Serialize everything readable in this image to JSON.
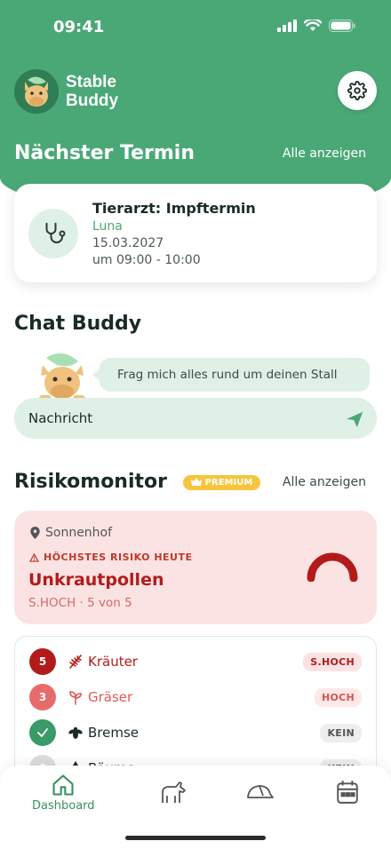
{
  "status_bar": {
    "time": "09:41"
  },
  "app": {
    "name_line1": "Stable",
    "name_line2": "Buddy"
  },
  "next_appointment": {
    "section_title": "Nächster Termin",
    "show_all": "Alle anzeigen",
    "title": "Tierarzt: Impftermin",
    "horse": "Luna",
    "date": "15.03.2027",
    "time": "um 09:00 - 10:00"
  },
  "chat": {
    "section_title": "Chat Buddy",
    "bubble": "Frag mich alles rund um deinen Stall",
    "input_placeholder": "Nachricht"
  },
  "risk": {
    "section_title": "Risikomonitor",
    "premium_label": "PREMIUM",
    "show_all": "Alle anzeigen",
    "location": "Sonnenhof",
    "highest_label": "HÖCHSTES RISIKO HEUTE",
    "highest_name": "Unkrautpollen",
    "highest_detail": "S.HOCH · 5 von 5",
    "highest_level": 5,
    "highest_max": 5,
    "items": [
      {
        "level": "5",
        "name": "Kräuter",
        "badge": "S.HOCH",
        "icon": "herb-icon",
        "color": "#b31b1b",
        "name_color": "#b31b1b",
        "badge_bg": "#fbe3e3",
        "badge_fg": "#b31b1b"
      },
      {
        "level": "3",
        "name": "Gräser",
        "badge": "HOCH",
        "icon": "sprout-icon",
        "color": "#e86b6b",
        "name_color": "#e05a5a",
        "badge_bg": "#fde7e7",
        "badge_fg": "#d9534f"
      },
      {
        "level": "",
        "name": "Bremse",
        "badge": "KEIN",
        "icon": "fly-icon",
        "color": "#3a9a68",
        "name_color": "#1a2b22",
        "badge_bg": "#eeeeee",
        "badge_fg": "#555555"
      },
      {
        "level": "0",
        "name": "Bäume",
        "badge": "KEIN",
        "icon": "tree-icon",
        "color": "#dddddd",
        "name_color": "#1a2b22",
        "badge_bg": "#eeeeee",
        "badge_fg": "#555555"
      }
    ]
  },
  "nav": {
    "dashboard_label": "Dashboard",
    "accent": "#3a8f60"
  }
}
